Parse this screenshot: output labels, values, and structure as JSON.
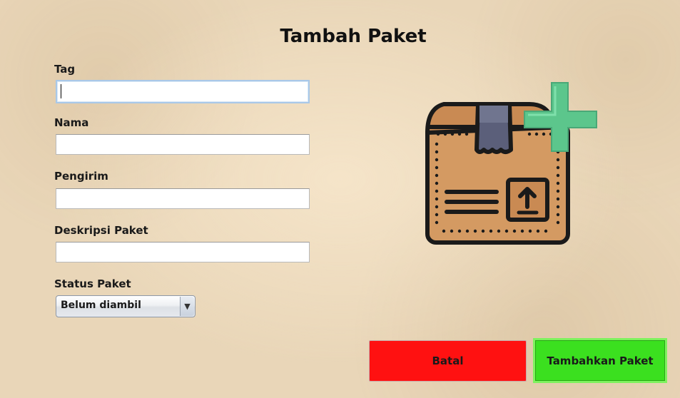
{
  "window": {
    "title": "Tambah Paket"
  },
  "form": {
    "tag": {
      "label": "Tag",
      "value": ""
    },
    "nama": {
      "label": "Nama",
      "value": ""
    },
    "pengirim": {
      "label": "Pengirim",
      "value": ""
    },
    "deskripsi": {
      "label": "Deskripsi Paket",
      "value": ""
    },
    "status": {
      "label": "Status Paket",
      "selected": "Belum diambil"
    }
  },
  "buttons": {
    "cancel_label": "Batal",
    "submit_label": "Tambahkan Paket"
  },
  "icons": {
    "illustration": "package-add-icon",
    "dropdown": "dropdown-arrow-icon"
  },
  "colors": {
    "cancel": "#ff1111",
    "submit": "#3be01f",
    "box": "#d49a62",
    "plus": "#5cc68c"
  }
}
